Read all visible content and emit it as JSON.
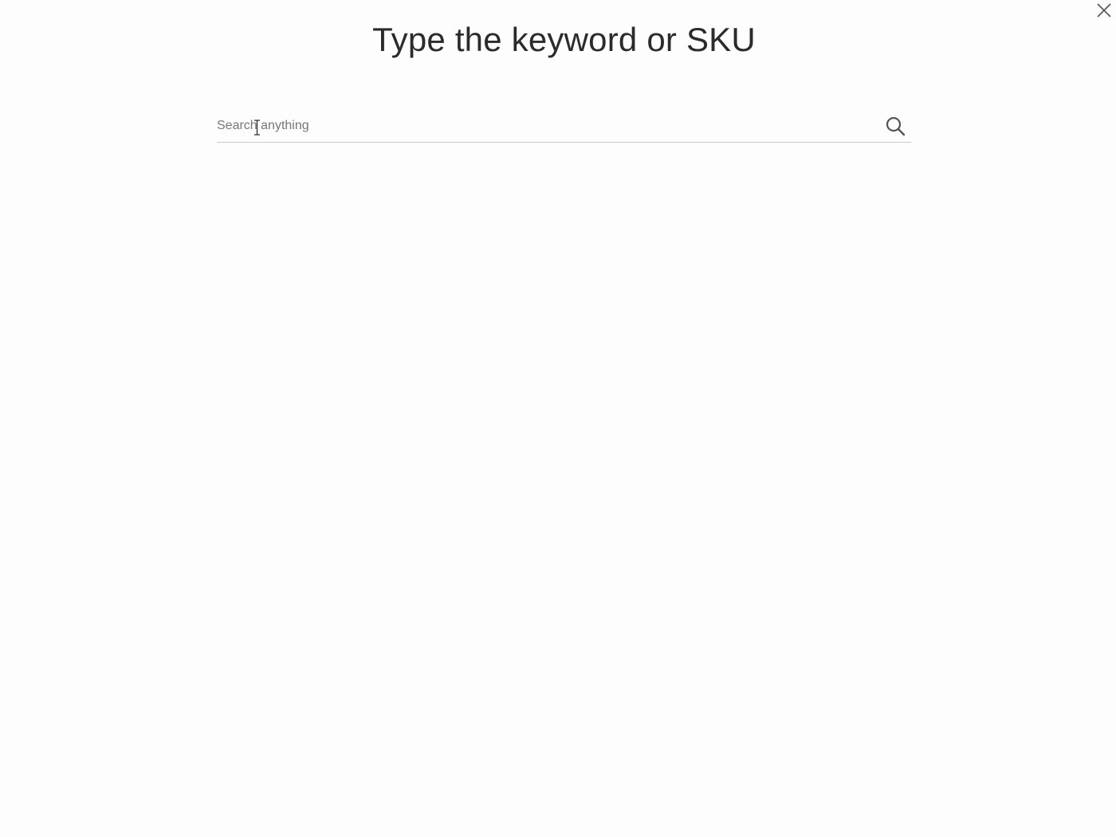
{
  "modal": {
    "title": "Type the keyword or SKU",
    "close_icon": "close-icon"
  },
  "search": {
    "placeholder": "Search anything",
    "value": "",
    "icon": "search-icon"
  },
  "colors": {
    "background": "#fdfdfd",
    "title_text": "#2b2b2b",
    "underline": "#c9c9c9",
    "icon": "#555555"
  }
}
